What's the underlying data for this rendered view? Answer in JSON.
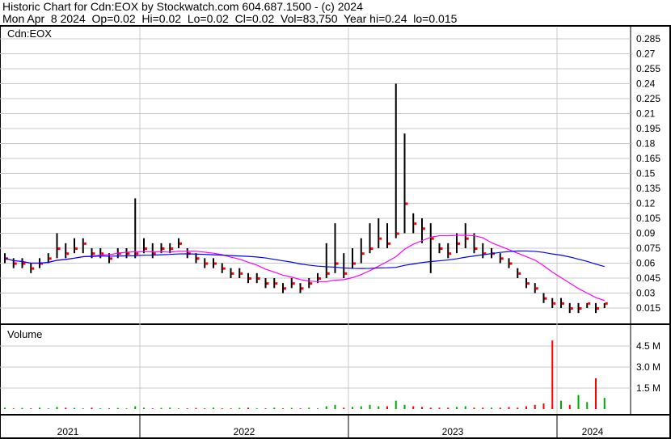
{
  "header": {
    "title": "Historic Chart for Cdn:EOX by Stockwatch.com 604.687.1500 - (c) 2024",
    "quote": "Mon Apr  8 2024  Op=0.02  Hi=0.02  Lo=0.02  Cl=0.02  Vol=83,750  Year hi=0.24  lo=0.015"
  },
  "chart_data": [
    {
      "type": "line",
      "title": "Cdn:EOX",
      "symbol": "Cdn:EOX",
      "y_ticks": [
        "0.015",
        "0.03",
        "0.045",
        "0.06",
        "0.075",
        "0.09",
        "0.105",
        "0.12",
        "0.135",
        "0.15",
        "0.165",
        "0.18",
        "0.195",
        "0.21",
        "0.225",
        "0.24",
        "0.255",
        "0.27",
        "0.285"
      ],
      "ylim": [
        0.0,
        0.295
      ],
      "x_labels": [
        "2021",
        "2022",
        "2023",
        "2024"
      ],
      "periods_per_year": 24,
      "start_offset": -16,
      "close": [
        0.065,
        0.06,
        0.06,
        0.055,
        0.06,
        0.065,
        0.075,
        0.07,
        0.075,
        0.08,
        0.07,
        0.07,
        0.065,
        0.07,
        0.07,
        0.07,
        0.075,
        0.07,
        0.075,
        0.075,
        0.08,
        0.07,
        0.065,
        0.06,
        0.06,
        0.055,
        0.05,
        0.05,
        0.045,
        0.045,
        0.04,
        0.04,
        0.035,
        0.04,
        0.035,
        0.04,
        0.045,
        0.05,
        0.06,
        0.05,
        0.06,
        0.07,
        0.075,
        0.085,
        0.08,
        0.09,
        0.12,
        0.1,
        0.095,
        0.085,
        0.075,
        0.07,
        0.08,
        0.085,
        0.075,
        0.07,
        0.07,
        0.065,
        0.06,
        0.05,
        0.04,
        0.035,
        0.025,
        0.02,
        0.02,
        0.015,
        0.015,
        0.02,
        0.015,
        0.02
      ],
      "high": [
        0.07,
        0.065,
        0.065,
        0.06,
        0.065,
        0.07,
        0.09,
        0.08,
        0.085,
        0.085,
        0.075,
        0.075,
        0.07,
        0.075,
        0.075,
        0.125,
        0.085,
        0.08,
        0.08,
        0.08,
        0.085,
        0.075,
        0.07,
        0.065,
        0.065,
        0.06,
        0.055,
        0.055,
        0.05,
        0.05,
        0.045,
        0.045,
        0.04,
        0.045,
        0.04,
        0.045,
        0.05,
        0.08,
        0.1,
        0.07,
        0.075,
        0.085,
        0.1,
        0.105,
        0.1,
        0.24,
        0.19,
        0.11,
        0.105,
        0.1,
        0.08,
        0.08,
        0.09,
        0.1,
        0.09,
        0.08,
        0.075,
        0.07,
        0.065,
        0.055,
        0.045,
        0.04,
        0.03,
        0.025,
        0.025,
        0.02,
        0.02,
        0.02,
        0.02,
        0.02
      ],
      "low": [
        0.06,
        0.055,
        0.055,
        0.05,
        0.055,
        0.06,
        0.065,
        0.065,
        0.07,
        0.07,
        0.065,
        0.065,
        0.06,
        0.065,
        0.065,
        0.065,
        0.07,
        0.065,
        0.07,
        0.07,
        0.075,
        0.065,
        0.06,
        0.055,
        0.055,
        0.05,
        0.045,
        0.045,
        0.04,
        0.04,
        0.035,
        0.035,
        0.03,
        0.035,
        0.03,
        0.035,
        0.04,
        0.045,
        0.05,
        0.045,
        0.055,
        0.06,
        0.07,
        0.075,
        0.075,
        0.085,
        0.09,
        0.09,
        0.08,
        0.05,
        0.07,
        0.065,
        0.07,
        0.075,
        0.07,
        0.065,
        0.065,
        0.06,
        0.055,
        0.045,
        0.035,
        0.03,
        0.02,
        0.015,
        0.015,
        0.01,
        0.01,
        0.015,
        0.01,
        0.015
      ],
      "ma_short": 10,
      "ma_long": 25,
      "volume": {
        "label": "Volume",
        "ticks": [
          "1.5 M",
          "3.0 M",
          "4.5 M"
        ],
        "ylim": [
          0,
          5.7
        ],
        "values": [
          0.1,
          0.05,
          0.08,
          0.05,
          0.1,
          0.05,
          0.15,
          0.1,
          0.08,
          0.05,
          0.1,
          0.05,
          0.05,
          0.08,
          0.05,
          0.2,
          0.1,
          0.05,
          0.08,
          0.1,
          0.05,
          0.05,
          0.08,
          0.05,
          0.1,
          0.05,
          0.05,
          0.08,
          0.1,
          0.05,
          0.05,
          0.1,
          0.05,
          0.08,
          0.05,
          0.1,
          0.05,
          0.2,
          0.3,
          0.1,
          0.15,
          0.2,
          0.3,
          0.2,
          0.2,
          0.6,
          0.3,
          0.2,
          0.15,
          0.1,
          0.1,
          0.1,
          0.15,
          0.2,
          0.1,
          0.1,
          0.1,
          0.1,
          0.15,
          0.1,
          0.2,
          0.3,
          0.4,
          4.9,
          0.6,
          0.3,
          1.0,
          0.5,
          2.2,
          0.8
        ]
      }
    }
  ]
}
